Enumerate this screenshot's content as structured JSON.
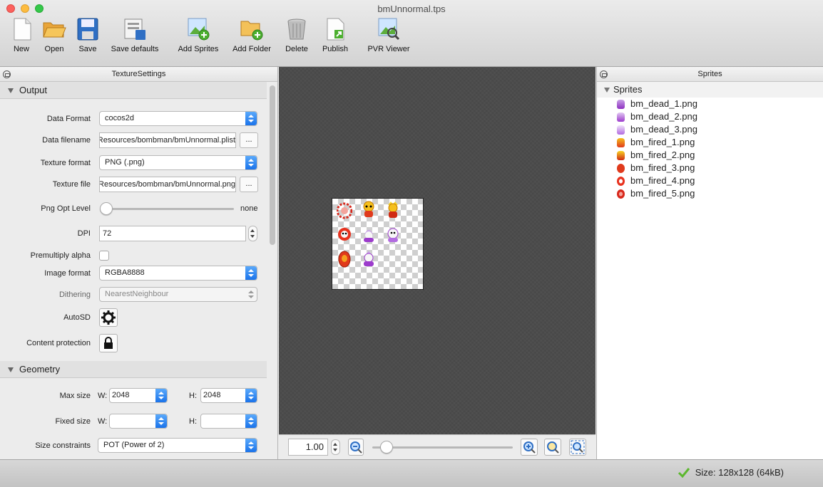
{
  "window": {
    "title": "bmUnnormal.tps"
  },
  "toolbar": {
    "new": "New",
    "open": "Open",
    "save": "Save",
    "save_defaults": "Save defaults",
    "add_sprites": "Add Sprites",
    "add_folder": "Add Folder",
    "delete": "Delete",
    "publish": "Publish",
    "pvr_viewer": "PVR Viewer"
  },
  "left_panel": {
    "title": "TextureSettings",
    "output": {
      "title": "Output",
      "data_format_label": "Data Format",
      "data_format": "cocos2d",
      "data_filename_label": "Data filename",
      "data_filename": "…/Resources/bombman/bmUnnormal.plist",
      "texture_format_label": "Texture format",
      "texture_format": "PNG (.png)",
      "texture_file_label": "Texture file",
      "texture_file": "…/Resources/bombman/bmUnnormal.png",
      "browse_label": "...",
      "png_opt_label": "Png Opt Level",
      "png_opt_value": "none",
      "png_opt_level": 0,
      "dpi_label": "DPI",
      "dpi": "72",
      "premultiply_label": "Premultiply alpha",
      "premultiply": false,
      "image_format_label": "Image format",
      "image_format": "RGBA8888",
      "dithering_label": "Dithering",
      "dithering": "NearestNeighbour",
      "autosd_label": "AutoSD",
      "content_protection_label": "Content protection"
    },
    "geometry": {
      "title": "Geometry",
      "max_size_label": "Max size",
      "w_label": "W:",
      "h_label": "H:",
      "max_w": "2048",
      "max_h": "2048",
      "fixed_size_label": "Fixed size",
      "fixed_w": "",
      "fixed_h": "",
      "size_constraints_label": "Size constraints",
      "size_constraints": "POT (Power of 2)"
    }
  },
  "canvas": {
    "zoom": "1.00",
    "zoom_slider": 0.1
  },
  "right_panel": {
    "title": "Sprites",
    "group": "Sprites",
    "items": [
      "bm_dead_1.png",
      "bm_dead_2.png",
      "bm_dead_3.png",
      "bm_fired_1.png",
      "bm_fired_2.png",
      "bm_fired_3.png",
      "bm_fired_4.png",
      "bm_fired_5.png"
    ]
  },
  "status": {
    "text": "Size: 128x128 (64kB)"
  },
  "colors": {
    "accent": "#1a73ea",
    "canvas_bg": "#4c4c4c",
    "ok_green": "#5cb82e"
  }
}
